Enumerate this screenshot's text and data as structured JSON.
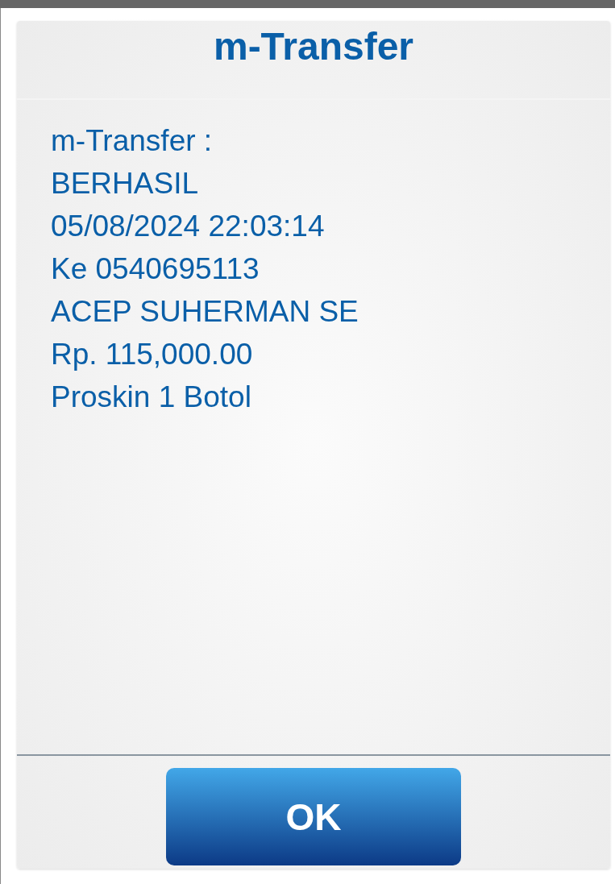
{
  "dialog": {
    "title": "m-Transfer",
    "lines": [
      "m-Transfer :",
      "BERHASIL",
      "05/08/2024 22:03:14",
      "Ke 0540695113",
      "ACEP SUHERMAN SE",
      "Rp. 115,000.00",
      "Proskin 1 Botol"
    ],
    "button": "OK"
  }
}
